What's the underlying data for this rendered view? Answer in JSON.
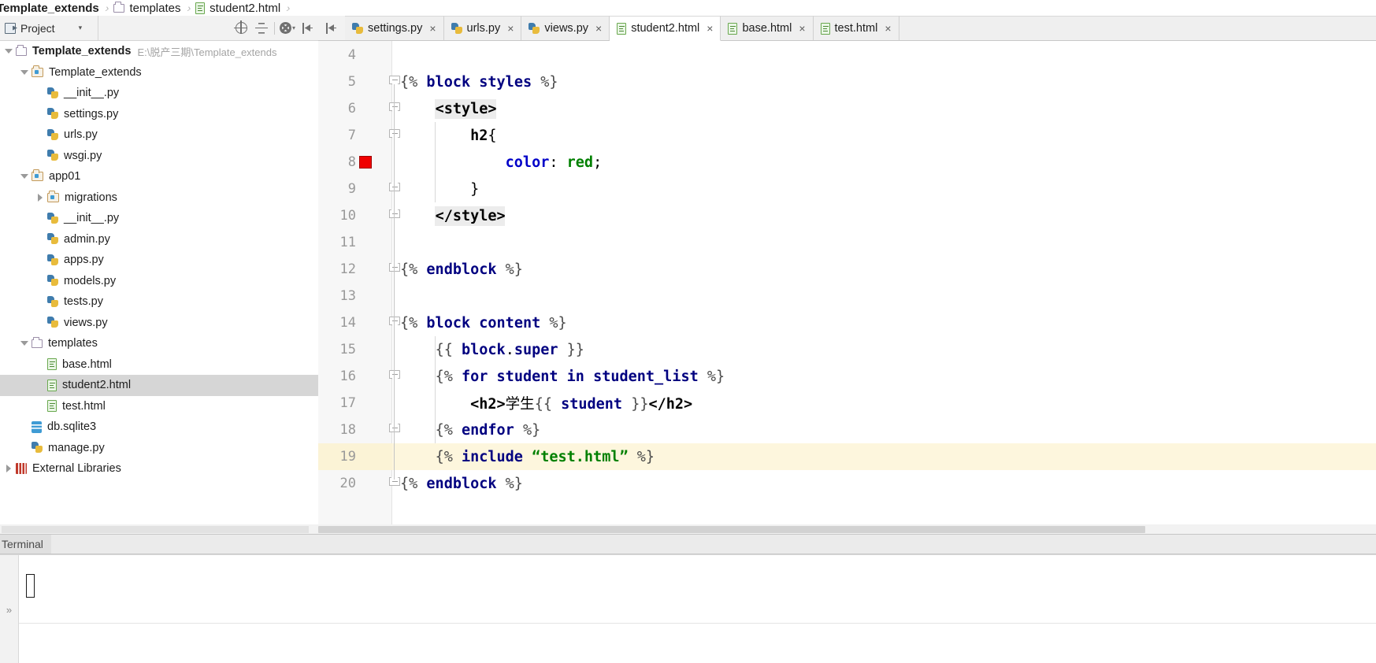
{
  "breadcrumb": {
    "items": [
      {
        "label": "Template_extends",
        "icon": "none",
        "bold": true
      },
      {
        "label": "templates",
        "icon": "folder-outline",
        "bold": false
      },
      {
        "label": "student2.html",
        "icon": "html-file",
        "bold": false
      }
    ],
    "separator": "›"
  },
  "project_panel": {
    "title": "Project",
    "caret": "▾",
    "toolbar": [
      {
        "name": "locate-icon",
        "tooltip": "Select Opened File"
      },
      {
        "name": "collapse-all-icon",
        "tooltip": "Collapse All"
      },
      {
        "name": "gear-icon",
        "tooltip": "Settings"
      },
      {
        "name": "hide-panel-icon",
        "tooltip": "Hide"
      }
    ],
    "tree": [
      {
        "depth": 0,
        "twisty": "down",
        "icon": "folder-outline",
        "label": "Template_extends",
        "bold": true,
        "path": "E:\\脱产三期\\Template_extends",
        "selected": false
      },
      {
        "depth": 1,
        "twisty": "down",
        "icon": "folder-module",
        "label": "Template_extends",
        "bold": false,
        "path": "",
        "selected": false
      },
      {
        "depth": 2,
        "twisty": "none",
        "icon": "py-file",
        "label": "__init__.py",
        "bold": false,
        "path": "",
        "selected": false
      },
      {
        "depth": 2,
        "twisty": "none",
        "icon": "py-file",
        "label": "settings.py",
        "bold": false,
        "path": "",
        "selected": false
      },
      {
        "depth": 2,
        "twisty": "none",
        "icon": "py-file",
        "label": "urls.py",
        "bold": false,
        "path": "",
        "selected": false
      },
      {
        "depth": 2,
        "twisty": "none",
        "icon": "py-file",
        "label": "wsgi.py",
        "bold": false,
        "path": "",
        "selected": false
      },
      {
        "depth": 1,
        "twisty": "down",
        "icon": "folder-module",
        "label": "app01",
        "bold": false,
        "path": "",
        "selected": false
      },
      {
        "depth": 2,
        "twisty": "right",
        "icon": "folder-module",
        "label": "migrations",
        "bold": false,
        "path": "",
        "selected": false
      },
      {
        "depth": 2,
        "twisty": "none",
        "icon": "py-file",
        "label": "__init__.py",
        "bold": false,
        "path": "",
        "selected": false
      },
      {
        "depth": 2,
        "twisty": "none",
        "icon": "py-file",
        "label": "admin.py",
        "bold": false,
        "path": "",
        "selected": false
      },
      {
        "depth": 2,
        "twisty": "none",
        "icon": "py-file",
        "label": "apps.py",
        "bold": false,
        "path": "",
        "selected": false
      },
      {
        "depth": 2,
        "twisty": "none",
        "icon": "py-file",
        "label": "models.py",
        "bold": false,
        "path": "",
        "selected": false
      },
      {
        "depth": 2,
        "twisty": "none",
        "icon": "py-file",
        "label": "tests.py",
        "bold": false,
        "path": "",
        "selected": false
      },
      {
        "depth": 2,
        "twisty": "none",
        "icon": "py-file",
        "label": "views.py",
        "bold": false,
        "path": "",
        "selected": false
      },
      {
        "depth": 1,
        "twisty": "down",
        "icon": "folder-outline",
        "label": "templates",
        "bold": false,
        "path": "",
        "selected": false
      },
      {
        "depth": 2,
        "twisty": "none",
        "icon": "html-file",
        "label": "base.html",
        "bold": false,
        "path": "",
        "selected": false
      },
      {
        "depth": 2,
        "twisty": "none",
        "icon": "html-file",
        "label": "student2.html",
        "bold": false,
        "path": "",
        "selected": true
      },
      {
        "depth": 2,
        "twisty": "none",
        "icon": "html-file",
        "label": "test.html",
        "bold": false,
        "path": "",
        "selected": false
      },
      {
        "depth": 1,
        "twisty": "none",
        "icon": "db-file",
        "label": "db.sqlite3",
        "bold": false,
        "path": "",
        "selected": false
      },
      {
        "depth": 1,
        "twisty": "none",
        "icon": "py-file",
        "label": "manage.py",
        "bold": false,
        "path": "",
        "selected": false
      },
      {
        "depth": 0,
        "twisty": "right",
        "icon": "library",
        "label": "External Libraries",
        "bold": false,
        "path": "",
        "selected": false
      }
    ]
  },
  "editor_tabs": {
    "close_glyph": "×",
    "items": [
      {
        "label": "settings.py",
        "icon": "py-file",
        "active": false
      },
      {
        "label": "urls.py",
        "icon": "py-file",
        "active": false
      },
      {
        "label": "views.py",
        "icon": "py-file",
        "active": false
      },
      {
        "label": "student2.html",
        "icon": "html-file",
        "active": true
      },
      {
        "label": "base.html",
        "icon": "html-file",
        "active": false
      },
      {
        "label": "test.html",
        "icon": "html-file",
        "active": false
      }
    ]
  },
  "editor": {
    "filename": "student2.html",
    "breakpoint_line": 8,
    "current_line": 19,
    "colors": {
      "django_tag": "#000080",
      "css_property": "#0000c8",
      "css_value": "#008000",
      "string": "#008000",
      "current_line_bg": "#fdf6dd",
      "breakpoint": "#f00000"
    },
    "lines": [
      {
        "no": 4,
        "text": ""
      },
      {
        "no": 5,
        "text": "{% block styles %}"
      },
      {
        "no": 6,
        "text": "    <style>"
      },
      {
        "no": 7,
        "text": "        h2{"
      },
      {
        "no": 8,
        "text": "            color: red;"
      },
      {
        "no": 9,
        "text": "        }"
      },
      {
        "no": 10,
        "text": "    </style>"
      },
      {
        "no": 11,
        "text": ""
      },
      {
        "no": 12,
        "text": "{% endblock %}"
      },
      {
        "no": 13,
        "text": ""
      },
      {
        "no": 14,
        "text": "{% block content %}"
      },
      {
        "no": 15,
        "text": "    {{ block.super }}"
      },
      {
        "no": 16,
        "text": "    {% for student in student_list %}"
      },
      {
        "no": 17,
        "text": "        <h2>学生{{ student }}</h2>"
      },
      {
        "no": 18,
        "text": "    {% endfor %}"
      },
      {
        "no": 19,
        "text": "    {% include “test.html” %}"
      },
      {
        "no": 20,
        "text": "{% endblock %}"
      }
    ]
  },
  "terminal": {
    "tab_label": "Terminal",
    "prompt_glyph": "»",
    "content": ""
  }
}
